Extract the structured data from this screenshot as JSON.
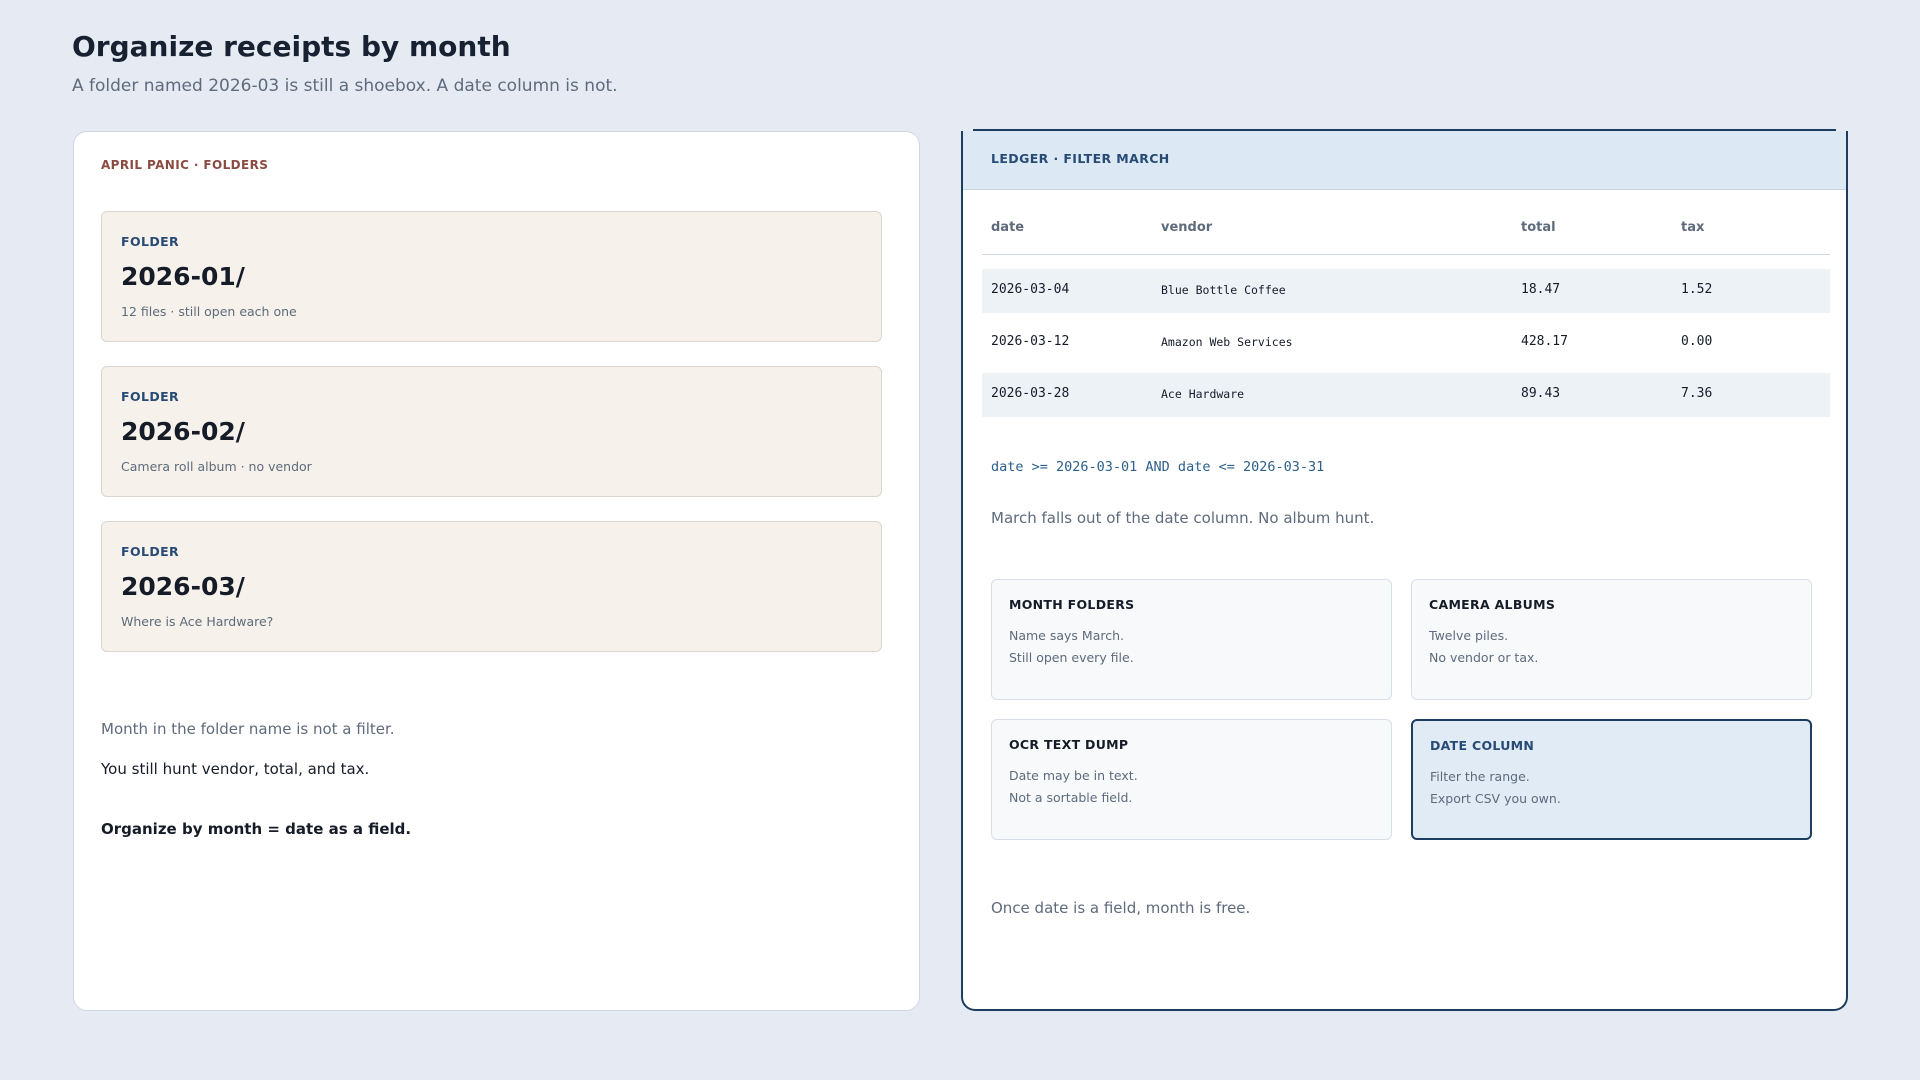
{
  "page": {
    "title": "Organize receipts by month",
    "subtitle": "A folder named 2026-03 is still a shoebox. A date column is not."
  },
  "left": {
    "eyebrow": "APRIL PANIC · FOLDERS",
    "folders": [
      {
        "kicker": "FOLDER",
        "name": "2026-01/",
        "note": "12 files · still open each one"
      },
      {
        "kicker": "FOLDER",
        "name": "2026-02/",
        "note": "Camera roll album · no vendor"
      },
      {
        "kicker": "FOLDER",
        "name": "2026-03/",
        "note": "Where is Ace Hardware?"
      }
    ],
    "line1": "Month in the folder name is not a filter.",
    "line2": "You still hunt vendor, total, and tax.",
    "conclusion": "Organize by month = date as a field."
  },
  "right": {
    "eyebrow": "LEDGER · FILTER MARCH",
    "table": {
      "headers": [
        "date",
        "vendor",
        "total",
        "tax"
      ],
      "rows": [
        [
          "2026-03-04",
          "Blue Bottle Coffee",
          "18.47",
          "1.52"
        ],
        [
          "2026-03-12",
          "Amazon Web Services",
          "428.17",
          "0.00"
        ],
        [
          "2026-03-28",
          "Ace Hardware",
          "89.43",
          "7.36"
        ]
      ]
    },
    "query": "date >= 2026-03-01 AND date <= 2026-03-31",
    "caption": "March falls out of the date column. No album hunt.",
    "options": [
      {
        "title": "MONTH FOLDERS",
        "line1": "Name says March.",
        "line2": "Still open every file."
      },
      {
        "title": "CAMERA ALBUMS",
        "line1": "Twelve piles.",
        "line2": "No vendor or tax."
      },
      {
        "title": "OCR TEXT DUMP",
        "line1": "Date may be in text.",
        "line2": "Not a sortable field."
      },
      {
        "title": "DATE COLUMN",
        "line1": "Filter the range.",
        "line2": "Export CSV you own."
      }
    ],
    "selected_option": "DATE COLUMN",
    "footer": "Once date is a field, month is free."
  }
}
